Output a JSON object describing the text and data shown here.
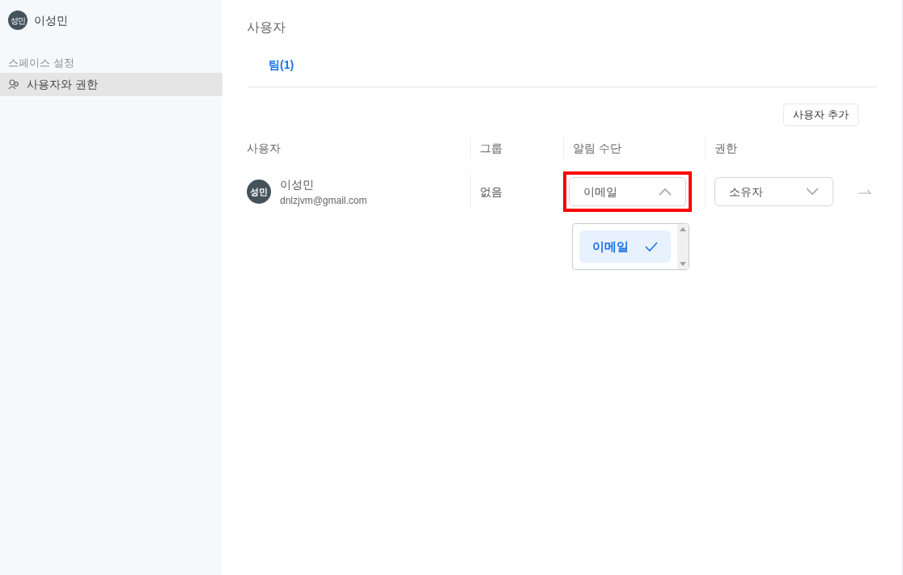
{
  "sidebar": {
    "user": {
      "avatar": "성민",
      "name": "이성민"
    },
    "section": "스페이스 설정",
    "items": [
      {
        "label": "사용자와 권한",
        "selected": true
      }
    ]
  },
  "main": {
    "title": "사용자",
    "tabs": [
      {
        "label": "팀(1)",
        "selected": true
      }
    ],
    "add_button": "사용자 추가",
    "table": {
      "columns": [
        "사용자",
        "그룹",
        "알림 수단",
        "권한"
      ],
      "rows": [
        {
          "avatar": "성민",
          "name": "이성민",
          "email": "dnlzjvm@gmail.com",
          "group": "없음",
          "notification": {
            "value": "이메일",
            "expanded": true,
            "highlighted": true,
            "options": [
              {
                "label": "이메일",
                "selected": true
              }
            ]
          },
          "role": {
            "value": "소유자",
            "expanded": false
          }
        }
      ]
    }
  }
}
